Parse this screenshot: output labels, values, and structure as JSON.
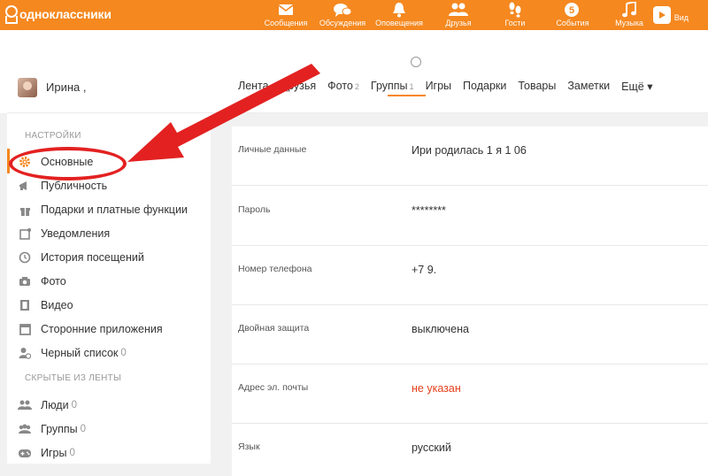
{
  "app": {
    "logo_text": "одноклассники"
  },
  "topnav": [
    {
      "id": "messages",
      "label": "Сообщения",
      "icon": "envelope-icon"
    },
    {
      "id": "discussions",
      "label": "Обсуждения",
      "icon": "chat-bubbles-icon"
    },
    {
      "id": "notifications",
      "label": "Оповещения",
      "icon": "bell-icon"
    },
    {
      "id": "friends",
      "label": "Друзья",
      "icon": "friends-icon"
    },
    {
      "id": "guests",
      "label": "Гости",
      "icon": "footprints-icon"
    },
    {
      "id": "events",
      "label": "События",
      "icon": "events-icon",
      "badge": "5"
    },
    {
      "id": "music",
      "label": "Музыка",
      "icon": "music-note-icon"
    },
    {
      "id": "video",
      "label": "Вид",
      "icon": "video-play-icon"
    }
  ],
  "profile": {
    "name": "Ирина ,",
    "tabs": [
      {
        "label": "Лента",
        "count": ""
      },
      {
        "label": "Друзья",
        "count": ""
      },
      {
        "label": "Фото",
        "count": "2"
      },
      {
        "label": "Группы",
        "count": "1"
      },
      {
        "label": "Игры",
        "count": ""
      },
      {
        "label": "Подарки",
        "count": ""
      },
      {
        "label": "Товары",
        "count": ""
      },
      {
        "label": "Заметки",
        "count": ""
      },
      {
        "label": "Ещё ▾",
        "count": ""
      }
    ]
  },
  "sidebar": {
    "section1": "НАСТРОЙКИ",
    "items": [
      {
        "label": "Основные",
        "icon": "gear-icon",
        "count": ""
      },
      {
        "label": "Публичность",
        "icon": "megaphone-icon",
        "count": ""
      },
      {
        "label": "Подарки и платные функции",
        "icon": "gift-icon",
        "count": ""
      },
      {
        "label": "Уведомления",
        "icon": "notification-square-icon",
        "count": ""
      },
      {
        "label": "История посещений",
        "icon": "history-icon",
        "count": ""
      },
      {
        "label": "Фото",
        "icon": "camera-icon",
        "count": ""
      },
      {
        "label": "Видео",
        "icon": "film-icon",
        "count": ""
      },
      {
        "label": "Сторонние приложения",
        "icon": "apps-icon",
        "count": ""
      },
      {
        "label": "Черный список",
        "icon": "blocked-user-icon",
        "count": "0"
      }
    ],
    "section2": "СКРЫТЫЕ ИЗ ЛЕНТЫ",
    "hidden": [
      {
        "label": "Люди",
        "icon": "people-icon",
        "count": "0"
      },
      {
        "label": "Группы",
        "icon": "groups-icon",
        "count": "0"
      },
      {
        "label": "Игры",
        "icon": "gamepad-icon",
        "count": "0"
      }
    ]
  },
  "settings": [
    {
      "key": "Личные данные",
      "value": "Ири             родилась 1 я     1  06",
      "warn": false
    },
    {
      "key": "Пароль",
      "value": "********",
      "warn": false
    },
    {
      "key": "Номер телефона",
      "value": "+7 9.",
      "warn": false
    },
    {
      "key": "Двойная защита",
      "value": "выключена",
      "warn": false
    },
    {
      "key": "Адрес эл. почты",
      "value": "не указан",
      "warn": true
    },
    {
      "key": "Язык",
      "value": "русский",
      "warn": false
    }
  ],
  "colors": {
    "brand": "#f5881f",
    "annotation": "#e32121",
    "warning": "#e4401b"
  }
}
